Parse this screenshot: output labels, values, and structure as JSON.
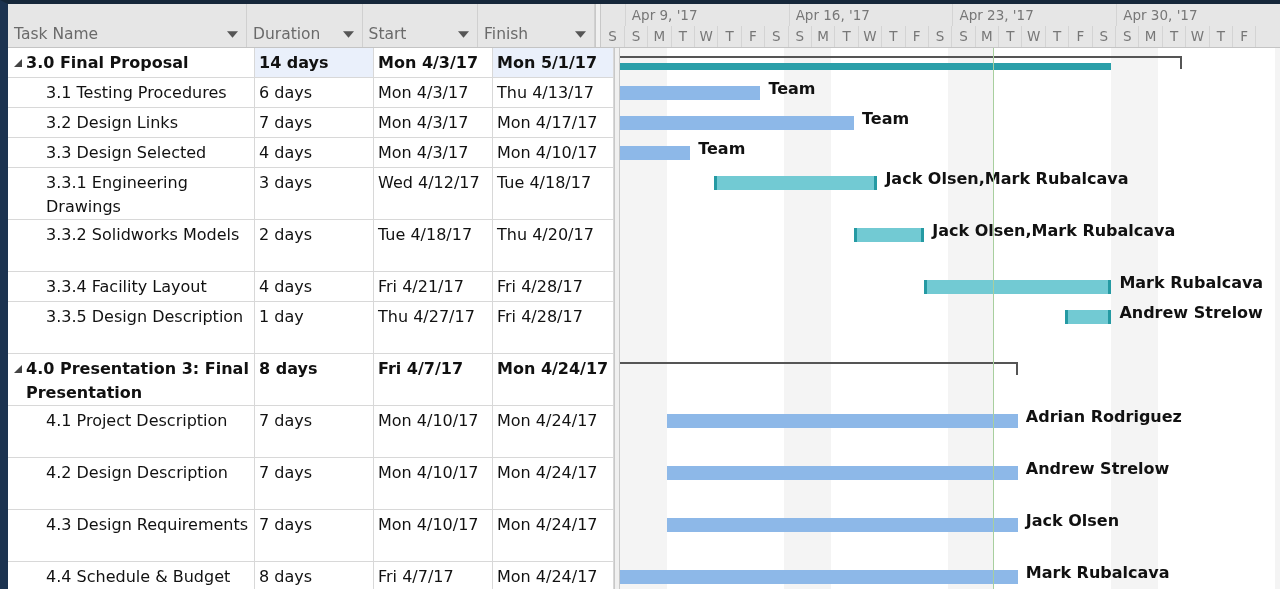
{
  "columns": [
    {
      "label": "Task Name"
    },
    {
      "label": "Duration"
    },
    {
      "label": "Start"
    },
    {
      "label": "Finish"
    }
  ],
  "timescale": {
    "weeks": [
      "Apr 9, '17",
      "Apr 16, '17",
      "Apr 23, '17",
      "Apr 30, '17"
    ],
    "days": [
      "S",
      "S",
      "M",
      "T",
      "W",
      "T",
      "F",
      "S",
      "S",
      "M",
      "T",
      "W",
      "T",
      "F",
      "S",
      "S",
      "M",
      "T",
      "W",
      "T",
      "F",
      "S",
      "S",
      "M",
      "T",
      "W",
      "T",
      "F"
    ]
  },
  "tasks": [
    {
      "name": "3.0 Final Proposal",
      "duration": "14 days",
      "start": "Mon 4/3/17",
      "finish": "Mon 5/1/17",
      "kind": "summary",
      "expanded": true,
      "selected": true,
      "rollup": true,
      "tall": false,
      "children": [
        {
          "name": "3.1 Testing Procedures",
          "duration": "6 days",
          "start": "Mon 4/3/17",
          "finish": "Thu 4/13/17",
          "kind": "task",
          "critical": false,
          "resource": "Team",
          "selected": false,
          "tall": false
        },
        {
          "name": "3.2 Design Links",
          "duration": "7 days",
          "start": "Mon 4/3/17",
          "finish": "Mon 4/17/17",
          "kind": "task",
          "critical": false,
          "resource": "Team",
          "selected": false,
          "tall": false
        },
        {
          "name": "3.3 Design Selected",
          "duration": "4 days",
          "start": "Mon 4/3/17",
          "finish": "Mon 4/10/17",
          "kind": "task",
          "critical": false,
          "resource": "Team",
          "selected": false,
          "tall": false
        },
        {
          "name": "3.3.1 Engineering Drawings",
          "duration": "3 days",
          "start": "Wed 4/12/17",
          "finish": "Tue 4/18/17",
          "kind": "task",
          "critical": true,
          "resource": "Jack Olsen,Mark Rubalcava",
          "selected": false,
          "tall": true
        },
        {
          "name": "3.3.2 Solidworks Models",
          "duration": "2 days",
          "start": "Tue 4/18/17",
          "finish": "Thu 4/20/17",
          "kind": "task",
          "critical": true,
          "resource": "Jack Olsen,Mark Rubalcava",
          "selected": false,
          "tall": true
        },
        {
          "name": "3.3.4 Facility Layout",
          "duration": "4 days",
          "start": "Fri 4/21/17",
          "finish": "Fri 4/28/17",
          "kind": "task",
          "critical": true,
          "resource": "Mark Rubalcava",
          "selected": false,
          "tall": false
        },
        {
          "name": "3.3.5 Design Description",
          "duration": "1 day",
          "start": "Thu 4/27/17",
          "finish": "Fri 4/28/17",
          "kind": "task",
          "critical": true,
          "resource": "Andrew Strelow",
          "selected": false,
          "tall": true
        }
      ]
    },
    {
      "name": "4.0 Presentation 3: Final Presentation",
      "duration": "8 days",
      "start": "Fri 4/7/17",
      "finish": "Mon 4/24/17",
      "kind": "summary",
      "expanded": true,
      "selected": false,
      "rollup": false,
      "tall": true,
      "children": [
        {
          "name": "4.1 Project Description",
          "duration": "7 days",
          "start": "Mon 4/10/17",
          "finish": "Mon 4/24/17",
          "kind": "task",
          "critical": false,
          "resource": "Adrian Rodriguez",
          "selected": false,
          "tall": true
        },
        {
          "name": "4.2 Design Description",
          "duration": "7 days",
          "start": "Mon 4/10/17",
          "finish": "Mon 4/24/17",
          "kind": "task",
          "critical": false,
          "resource": "Andrew Strelow",
          "selected": false,
          "tall": true
        },
        {
          "name": "4.3 Design Requirements",
          "duration": "7 days",
          "start": "Mon 4/10/17",
          "finish": "Mon 4/24/17",
          "kind": "task",
          "critical": false,
          "resource": "Jack Olsen",
          "selected": false,
          "tall": true
        },
        {
          "name": "4.4 Schedule & Budget",
          "duration": "8 days",
          "start": "Fri 4/7/17",
          "finish": "Mon 4/24/17",
          "kind": "task",
          "critical": false,
          "resource": "Mark Rubalcava",
          "selected": false,
          "tall": true
        }
      ]
    }
  ]
}
